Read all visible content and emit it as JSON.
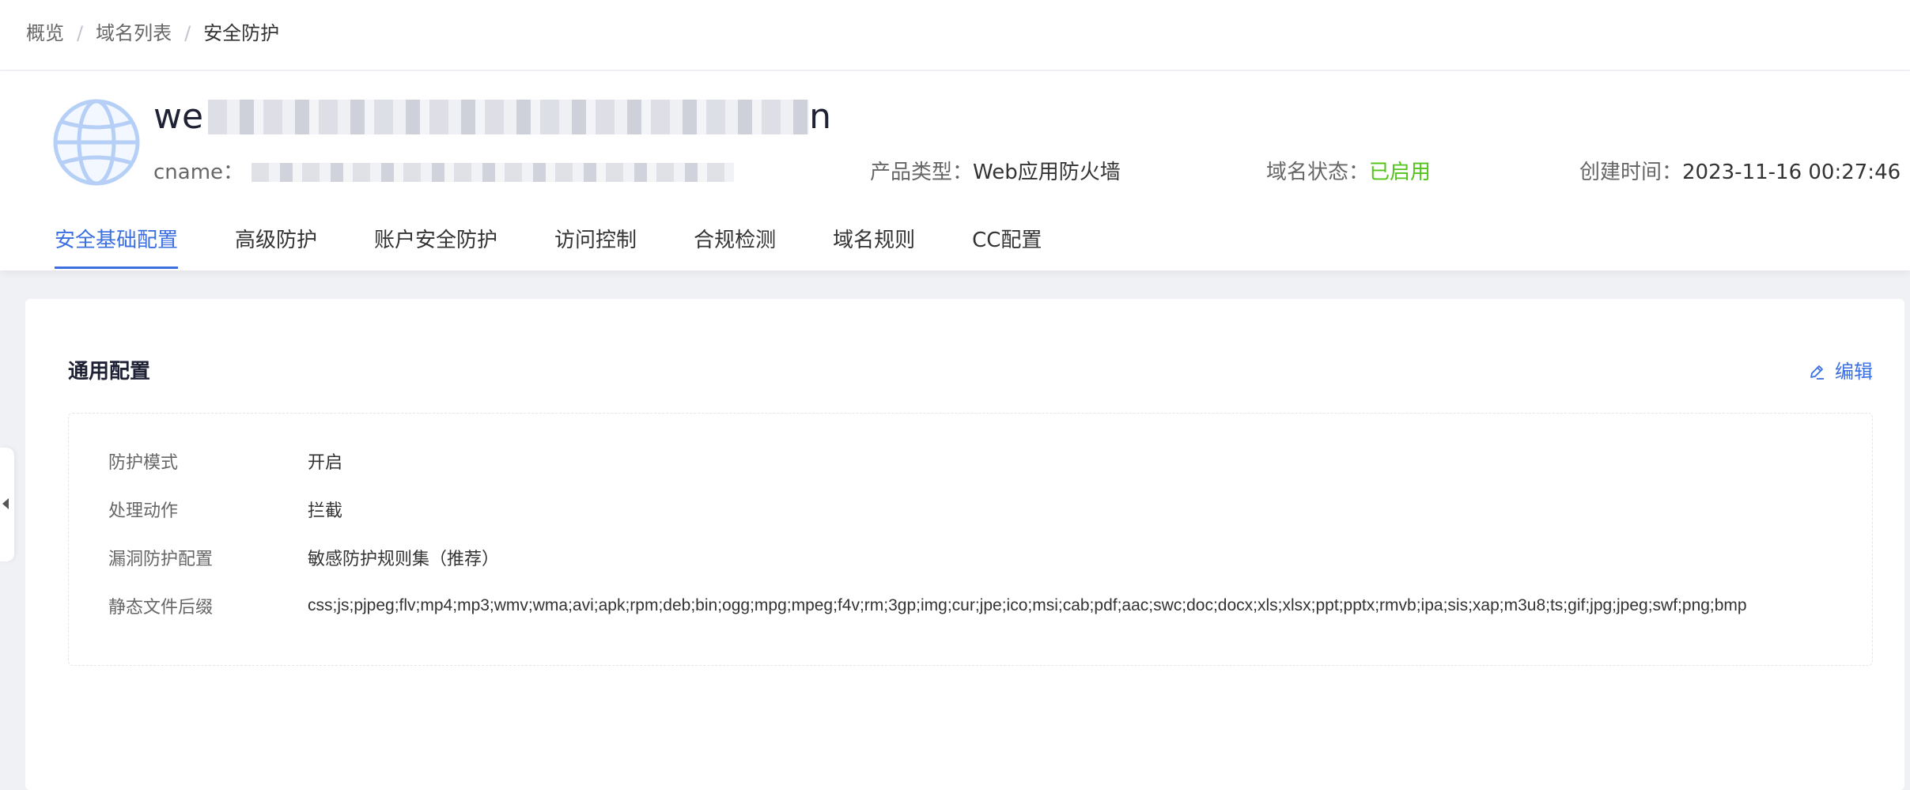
{
  "breadcrumb": [
    {
      "label": "概览"
    },
    {
      "label": "域名列表"
    },
    {
      "label": "安全防护"
    }
  ],
  "breadcrumb_separator": "/",
  "header": {
    "domain_prefix": "we",
    "domain_suffix": "n",
    "cname_label": "cname：",
    "product_type_label": "产品类型：",
    "product_type_value": "Web应用防火墙",
    "domain_status_label": "域名状态：",
    "domain_status_value": "已启用",
    "created_time_label": "创建时间：",
    "created_time_value": "2023-11-16 00:27:46",
    "status_color": "#52c41a",
    "icon": "globe-icon"
  },
  "tabs": [
    {
      "label": "安全基础配置",
      "active": true
    },
    {
      "label": "高级防护",
      "active": false
    },
    {
      "label": "账户安全防护",
      "active": false
    },
    {
      "label": "访问控制",
      "active": false
    },
    {
      "label": "合规检测",
      "active": false
    },
    {
      "label": "域名规则",
      "active": false
    },
    {
      "label": "CC配置",
      "active": false
    }
  ],
  "section": {
    "title": "通用配置",
    "edit_label": "编辑",
    "edit_icon": "pencil-icon"
  },
  "config": [
    {
      "label": "防护模式",
      "value": "开启"
    },
    {
      "label": "处理动作",
      "value": "拦截"
    },
    {
      "label": "漏洞防护配置",
      "value": "敏感防护规则集（推荐）"
    },
    {
      "label": "静态文件后缀",
      "value": "css;js;pjpeg;flv;mp4;mp3;wmv;wma;avi;apk;rpm;deb;bin;ogg;mpg;mpeg;f4v;rm;3gp;img;cur;jpe;ico;msi;cab;pdf;aac;swc;doc;docx;xls;xlsx;ppt;pptx;rmvb;ipa;sis;xap;m3u8;ts;gif;jpg;jpeg;swf;png;bmp"
    }
  ],
  "colors": {
    "accent": "#3b6fe0",
    "success": "#52c41a",
    "background": "#f0f1f5"
  }
}
